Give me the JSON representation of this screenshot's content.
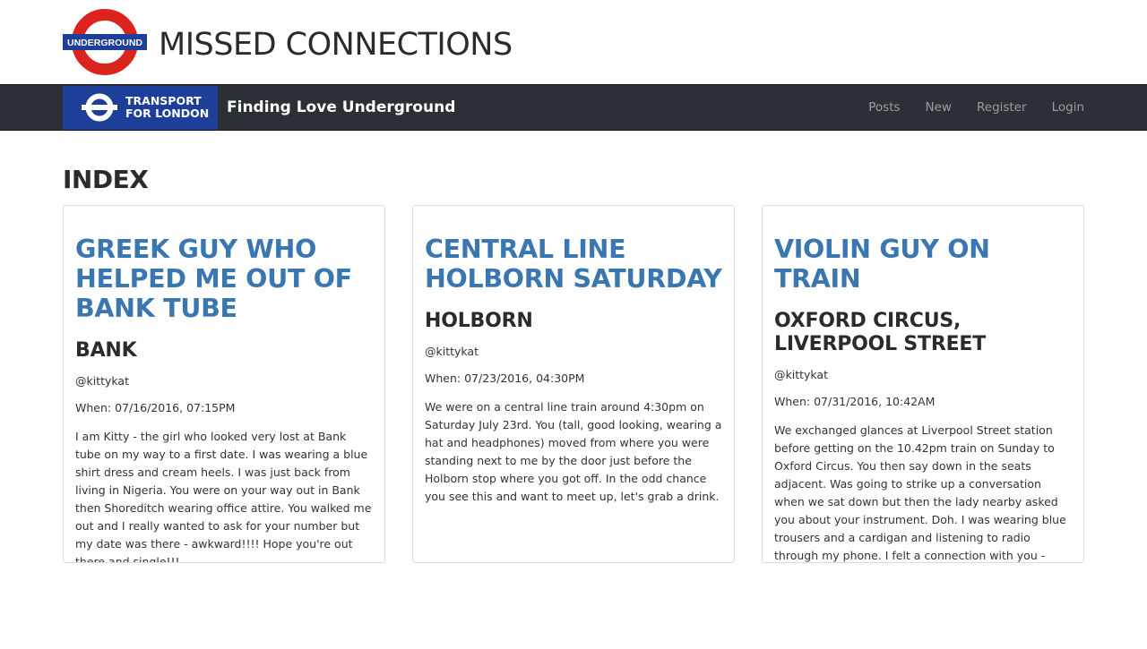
{
  "header": {
    "logo_text": "UNDERGROUND",
    "title": "MISSED CONNECTIONS"
  },
  "navbar": {
    "tfl_line1": "TRANSPORT",
    "tfl_line2": "FOR LONDON",
    "brand": "Finding Love Underground",
    "links": [
      "Posts",
      "New",
      "Register",
      "Login"
    ]
  },
  "page": {
    "heading": "INDEX"
  },
  "colors": {
    "roundel_red": "#dc241f",
    "roundel_blue": "#1d3f9a",
    "navbar_bg": "#2c2f36",
    "title_blue": "#3a76b0"
  },
  "posts": [
    {
      "title": "GREEK GUY WHO HELPED ME OUT OF BANK TUBE",
      "station": "BANK",
      "author": "@kittykat",
      "when": "When: 07/16/2016, 07:15PM",
      "body": "I am Kitty - the girl who looked very lost at Bank tube on my way to a first date. I was wearing a blue shirt dress and cream heels. I was just back from living in Nigeria. You were on your way out in Bank then Shoreditch wearing office attire. You walked me out and I really wanted to ask for your number but my date was there - awkward!!!! Hope you're out there and single!!!"
    },
    {
      "title": "CENTRAL LINE HOLBORN SATURDAY",
      "station": "HOLBORN",
      "author": "@kittykat",
      "when": "When: 07/23/2016, 04:30PM",
      "body": "We were on a central line train around 4:30pm on Saturday July 23rd. You (tall, good looking, wearing a hat and headphones) moved from where you were standing next to me by the door just before the Holborn stop where you got off. In the odd chance you see this and want to meet up, let's grab a drink."
    },
    {
      "title": "VIOLIN GUY ON TRAIN",
      "station": "OXFORD CIRCUS, LIVERPOOL STREET",
      "author": "@kittykat",
      "when": "When: 07/31/2016, 10:42AM",
      "body": "We exchanged glances at Liverpool Street station before getting on the 10.42pm train on Sunday to Oxford Circus. You then say down in the seats adjacent. Was going to strike up a conversation when we sat down but then the lady nearby asked you about your instrument. Doh. I was wearing blue trousers and a cardigan and listening to radio through my phone. I felt a connection with you - would love to meet properly for a drink or coffee!"
    }
  ]
}
